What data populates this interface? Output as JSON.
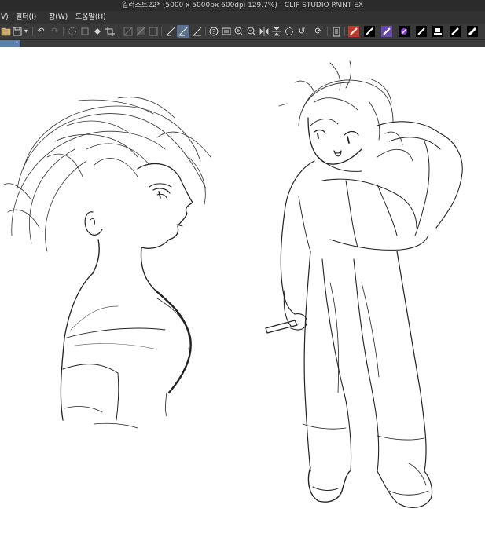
{
  "window": {
    "title": "일러스트22* (5000 x 5000px 600dpi 129.7%) - CLIP STUDIO PAINT EX"
  },
  "menu": {
    "items": [
      {
        "label": "V)"
      },
      {
        "label": "필터(I)"
      },
      {
        "label": "창(W)"
      },
      {
        "label": "도움말(H)"
      }
    ]
  },
  "toolbar": {
    "groups": [
      {
        "name": "file",
        "icons": [
          "open-folder-icon",
          "save-icon",
          "dropdown-arrow-icon"
        ]
      },
      {
        "name": "history",
        "icons": [
          "undo-icon",
          "redo-icon"
        ]
      },
      {
        "name": "selection",
        "icons": [
          "clear-selection-icon",
          "transform-icon",
          "fill-icon",
          "crop-icon"
        ]
      },
      {
        "name": "display",
        "icons": [
          "ruler-icon",
          "perspective-icon",
          "frame-icon",
          "snap-icon",
          "snap-active-icon",
          "snap-grid-icon"
        ]
      },
      {
        "name": "view",
        "icons": [
          "help-icon",
          "layers-icon",
          "zoom-in-icon",
          "zoom-out-icon",
          "flip-horizontal-icon",
          "flip-vertical-icon",
          "rotate-icon",
          "reset-rotation-icon",
          "refresh-icon"
        ]
      },
      {
        "name": "brushes",
        "icons": [
          "tablet-icon",
          "red-pen-icon",
          "ink-pen-icon",
          "purple-pen-icon",
          "purple-brush-icon",
          "black-pen-icon",
          "stamp-icon",
          "eraser-icon",
          "marker-icon"
        ]
      }
    ]
  },
  "document_tab": {
    "label": "*",
    "close": "×"
  },
  "colors": {
    "titlebar": "#2b2b2b",
    "menubar": "#323232",
    "toolbar": "#3a3a3a",
    "active_tab": "#5a7fb3",
    "active_tool": "#5b6f8f",
    "ink": "#222222"
  }
}
